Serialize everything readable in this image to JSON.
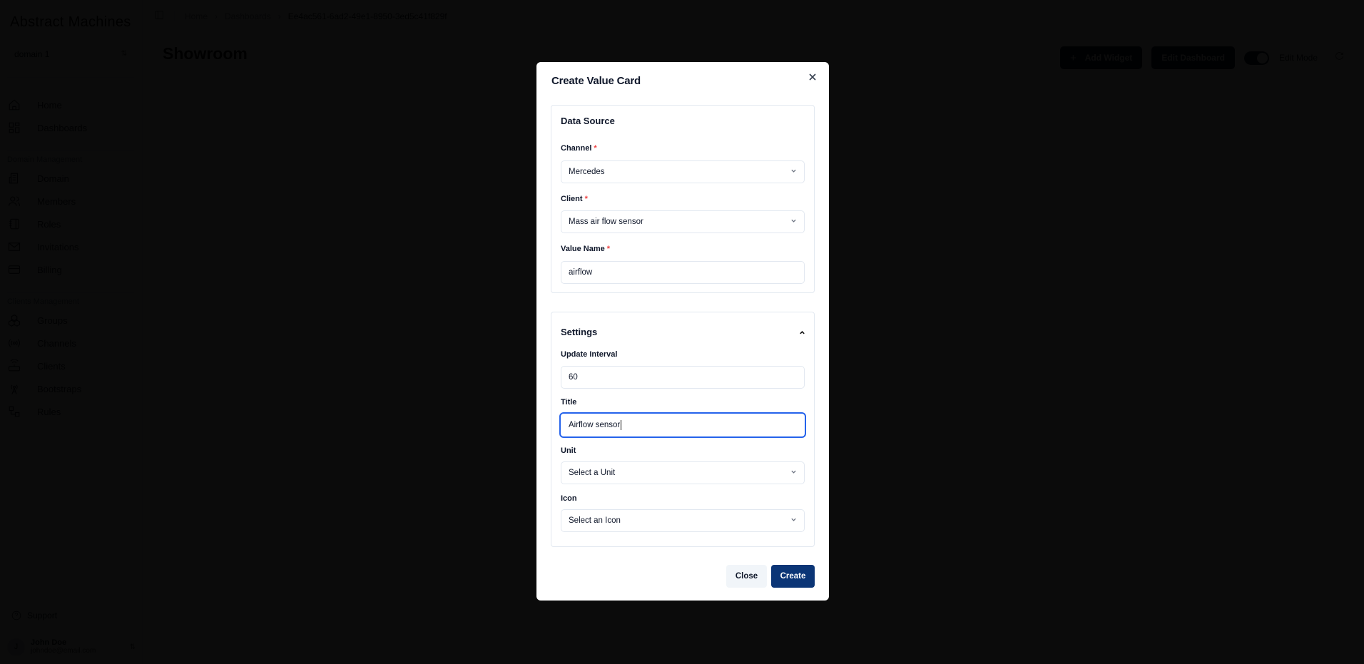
{
  "sidebar": {
    "logo": "Abstract Machines",
    "domain_select": "domain 1",
    "top_items": [
      {
        "label": "Home",
        "icon": "home-icon"
      },
      {
        "label": "Dashboards",
        "icon": "dashboards-icon"
      }
    ],
    "domain_section": {
      "label": "Domain Management",
      "items": [
        {
          "label": "Domain",
          "icon": "domain-icon"
        },
        {
          "label": "Members",
          "icon": "members-icon"
        },
        {
          "label": "Roles",
          "icon": "roles-icon"
        },
        {
          "label": "Invitations",
          "icon": "mail-icon"
        },
        {
          "label": "Billing",
          "icon": "credit-card-icon"
        }
      ]
    },
    "clients_section": {
      "label": "Clients Management",
      "items": [
        {
          "label": "Groups",
          "icon": "groups-icon"
        },
        {
          "label": "Channels",
          "icon": "channels-icon"
        },
        {
          "label": "Clients",
          "icon": "router-icon"
        },
        {
          "label": "Bootstraps",
          "icon": "antenna-icon"
        },
        {
          "label": "Rules",
          "icon": "rules-icon"
        }
      ]
    },
    "support": "Support",
    "user": {
      "initial": "J",
      "name": "John Doe",
      "email": "johndoe@email.com"
    }
  },
  "header": {
    "breadcrumb": [
      "Home",
      "Dashboards",
      "Ee4ac561-6ad2-49e1-8950-3ed5c41f829f"
    ],
    "page_title": "Showroom",
    "add_widget": "Add Widget",
    "edit_dashboard": "Edit Dashboard",
    "edit_mode_label": "Edit Mode",
    "edit_mode_on": true
  },
  "modal": {
    "title": "Create Value Card",
    "data_source": {
      "title": "Data Source",
      "channel_label": "Channel",
      "channel_value": "Mercedes",
      "client_label": "Client",
      "client_value": "Mass air flow sensor",
      "value_name_label": "Value Name",
      "value_name_value": "airflow",
      "required_mark": "*"
    },
    "settings": {
      "title": "Settings",
      "update_interval_label": "Update Interval",
      "update_interval_value": "60",
      "title_label": "Title",
      "title_value": "Airflow sensor",
      "unit_label": "Unit",
      "unit_placeholder": "Select a Unit",
      "icon_label": "Icon",
      "icon_placeholder": "Select an Icon"
    },
    "close_label": "Close",
    "create_label": "Create",
    "accent_color": "#0b3576",
    "focus_color": "#2563eb"
  }
}
